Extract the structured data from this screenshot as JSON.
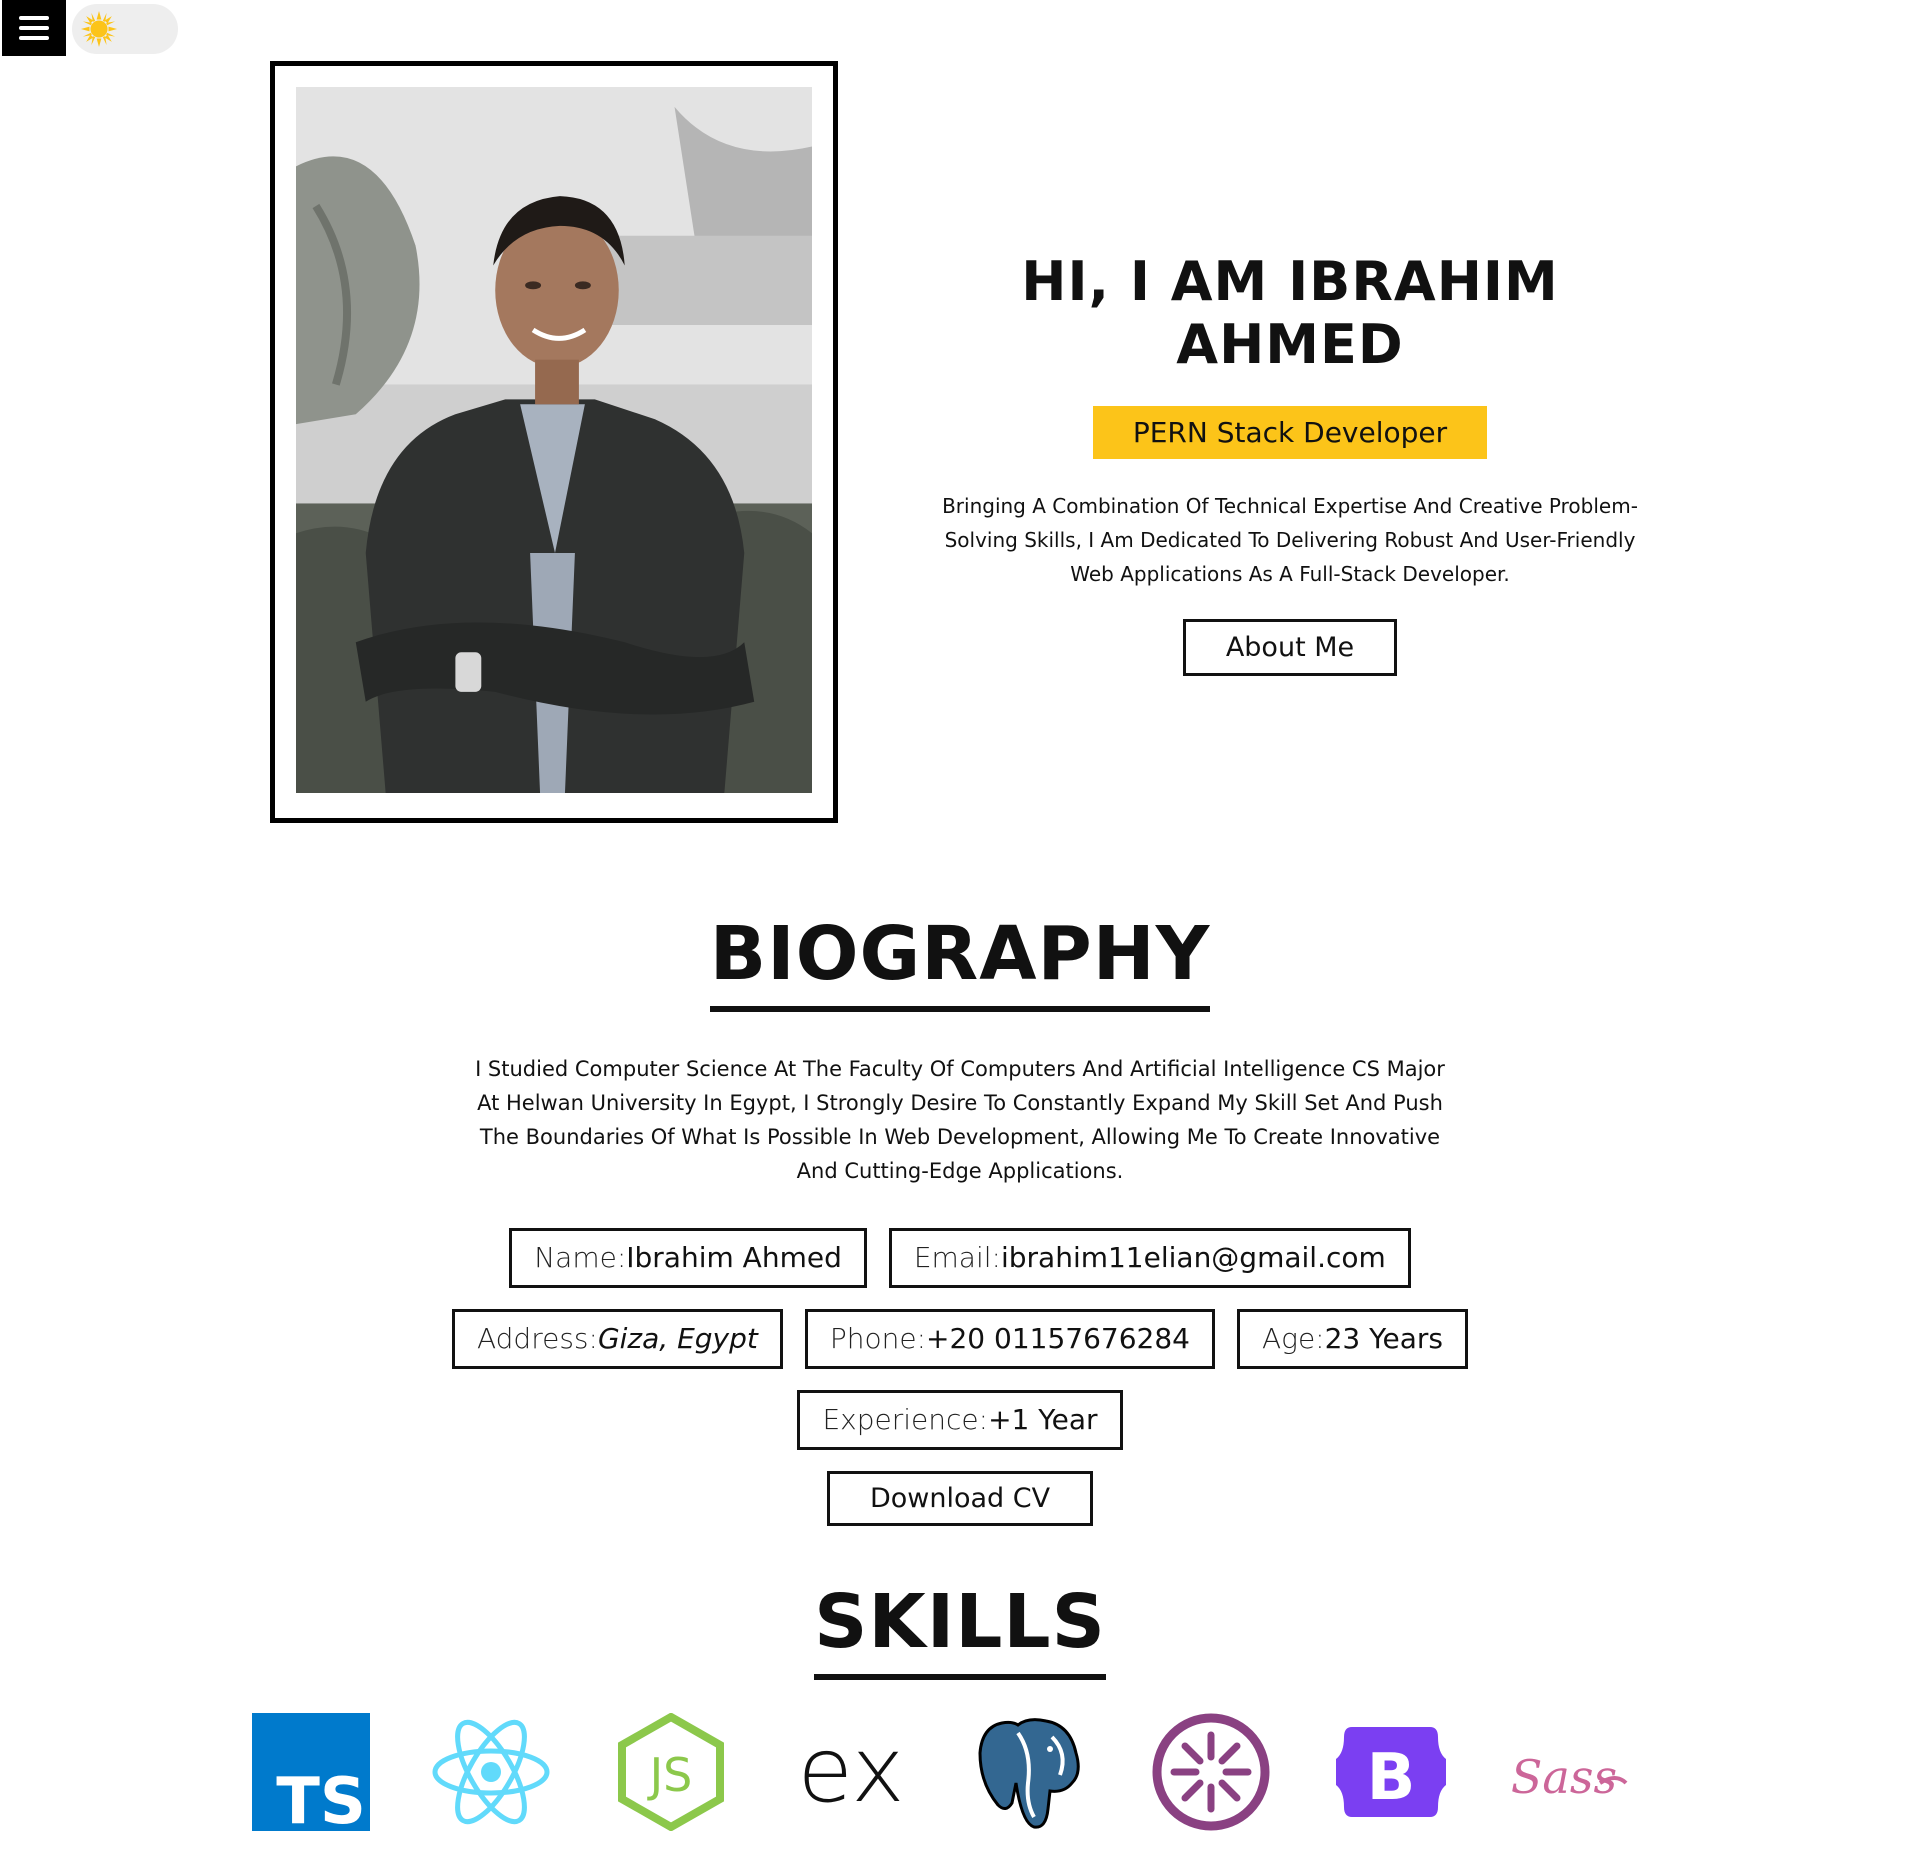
{
  "hero": {
    "title": "HI, I AM IBRAHIM AHMED",
    "role": "PERN Stack Developer",
    "description": "Bringing A Combination Of Technical Expertise And Creative Problem-Solving Skills, I Am Dedicated To Delivering Robust And User-Friendly Web Applications As A Full-Stack Developer.",
    "about_button": "About Me"
  },
  "biography": {
    "title": "BIOGRAPHY",
    "text": "I Studied Computer Science At The Faculty Of Computers And Artificial Intelligence CS Major At Helwan University In Egypt, I Strongly Desire To Constantly Expand My Skill Set And Push The Boundaries Of What Is Possible In Web Development, Allowing Me To Create Innovative And Cutting-Edge Applications.",
    "info": {
      "name_key": "Name:",
      "name_val": "Ibrahim Ahmed",
      "email_key": "Email:",
      "email_val": "ibrahim11elian@gmail.com",
      "address_key": "Address:",
      "address_val": "Giza, Egypt",
      "phone_key": "Phone:",
      "phone_val": "+20 01157676284",
      "age_key": "Age:",
      "age_val": "23 Years",
      "experience_key": "Experience:",
      "experience_val": "+1 Year"
    },
    "download_button": "Download CV"
  },
  "skills": {
    "title": "SKILLS",
    "icons": [
      {
        "name": "typescript-icon",
        "label": "TS",
        "color": "#007acc"
      },
      {
        "name": "react-icon",
        "color": "#61dafb"
      },
      {
        "name": "nodejs-icon",
        "label": "JS",
        "color": "#8cc84b"
      },
      {
        "name": "express-icon",
        "label": "ex",
        "color": "#111111"
      },
      {
        "name": "postgresql-icon",
        "color": "#336791"
      },
      {
        "name": "jest-icon",
        "color": "#99425b"
      },
      {
        "name": "bootstrap-icon",
        "label": "B",
        "color": "#7952b3"
      },
      {
        "name": "sass-icon",
        "label": "Sass",
        "color": "#cc6699"
      }
    ]
  },
  "colors": {
    "accent": "#fcc419",
    "text": "#111111",
    "background": "#ffffff"
  }
}
